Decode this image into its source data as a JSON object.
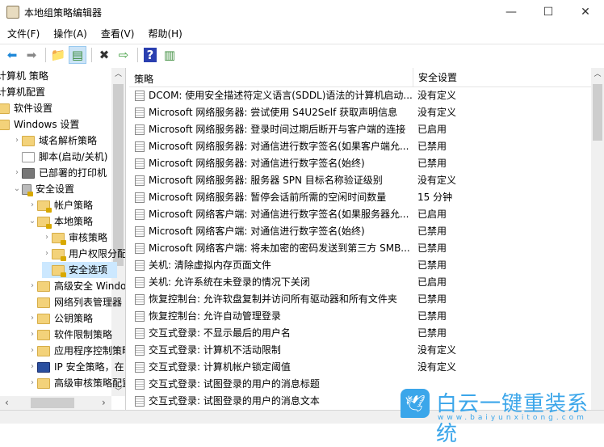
{
  "window": {
    "title": "本地组策略编辑器",
    "minimize": "—",
    "maximize": "☐",
    "close": "✕"
  },
  "menu": [
    "文件(F)",
    "操作(A)",
    "查看(V)",
    "帮助(H)"
  ],
  "toolbar": [
    {
      "icon": "back-arrow-icon",
      "glyph": "⬅",
      "color": "#1e88d8"
    },
    {
      "icon": "forward-arrow-icon",
      "glyph": "➡",
      "color": "#888888"
    },
    {
      "icon": "up-folder-icon",
      "glyph": "📁",
      "color": "#d6ad48"
    },
    {
      "icon": "show-hide-tree-icon",
      "glyph": "▤",
      "color": "#3c8c3c"
    },
    {
      "icon": "delete-icon",
      "glyph": "✖",
      "color": "#333333"
    },
    {
      "icon": "export-list-icon",
      "glyph": "⇨",
      "color": "#3c9c3c"
    },
    {
      "icon": "help-icon",
      "glyph": "?",
      "color": "#2a3fb0"
    },
    {
      "icon": "action-pane-icon",
      "glyph": "▥",
      "color": "#3c8c3c"
    }
  ],
  "tree": [
    {
      "label": "计算机 策略",
      "indent": 0,
      "chev": "",
      "icon": "none"
    },
    {
      "label": "计算机配置",
      "indent": 0,
      "chev": "",
      "icon": "none"
    },
    {
      "label": "软件设置",
      "indent": 0,
      "chev": "",
      "icon": "folder"
    },
    {
      "label": "Windows 设置",
      "indent": 0,
      "chev": "",
      "icon": "folder"
    },
    {
      "label": "域名解析策略",
      "indent": 1,
      "chev": "›",
      "icon": "folder"
    },
    {
      "label": "脚本(启动/关机)",
      "indent": 1,
      "chev": "",
      "icon": "script"
    },
    {
      "label": "已部署的打印机",
      "indent": 1,
      "chev": "›",
      "icon": "printer"
    },
    {
      "label": "安全设置",
      "indent": 1,
      "chev": "⌄",
      "icon": "security"
    },
    {
      "label": "帐户策略",
      "indent": 2,
      "chev": "›",
      "icon": "lockfolder"
    },
    {
      "label": "本地策略",
      "indent": 2,
      "chev": "⌄",
      "icon": "lockfolder"
    },
    {
      "label": "审核策略",
      "indent": 3,
      "chev": "›",
      "icon": "lockfolder"
    },
    {
      "label": "用户权限分配",
      "indent": 3,
      "chev": "›",
      "icon": "lockfolder"
    },
    {
      "label": "安全选项",
      "indent": 3,
      "chev": "",
      "icon": "lockfolder",
      "selected": true
    },
    {
      "label": "高级安全 Windows",
      "indent": 2,
      "chev": "›",
      "icon": "folder"
    },
    {
      "label": "网络列表管理器",
      "indent": 2,
      "chev": "",
      "icon": "folder"
    },
    {
      "label": "公钥策略",
      "indent": 2,
      "chev": "›",
      "icon": "folder"
    },
    {
      "label": "软件限制策略",
      "indent": 2,
      "chev": "›",
      "icon": "folder"
    },
    {
      "label": "应用程序控制策略",
      "indent": 2,
      "chev": "›",
      "icon": "folder"
    },
    {
      "label": "IP 安全策略，在",
      "indent": 2,
      "chev": "›",
      "icon": "ipsec"
    },
    {
      "label": "高级审核策略配置",
      "indent": 2,
      "chev": "›",
      "icon": "folder"
    }
  ],
  "list": {
    "columns": [
      "策略",
      "安全设置"
    ],
    "rows": [
      [
        "DCOM: 使用安全描述符定义语言(SDDL)语法的计算机启动...",
        "没有定义"
      ],
      [
        "Microsoft 网络服务器: 尝试使用 S4U2Self 获取声明信息",
        "没有定义"
      ],
      [
        "Microsoft 网络服务器: 登录时间过期后断开与客户端的连接",
        "已启用"
      ],
      [
        "Microsoft 网络服务器: 对通信进行数字签名(如果客户端允...",
        "已禁用"
      ],
      [
        "Microsoft 网络服务器: 对通信进行数字签名(始终)",
        "已禁用"
      ],
      [
        "Microsoft 网络服务器: 服务器 SPN 目标名称验证级别",
        "没有定义"
      ],
      [
        "Microsoft 网络服务器: 暂停会话前所需的空闲时间数量",
        "15 分钟"
      ],
      [
        "Microsoft 网络客户端: 对通信进行数字签名(如果服务器允...",
        "已启用"
      ],
      [
        "Microsoft 网络客户端: 对通信进行数字签名(始终)",
        "已禁用"
      ],
      [
        "Microsoft 网络客户端: 将未加密的密码发送到第三方 SMB...",
        "已禁用"
      ],
      [
        "关机: 清除虚拟内存页面文件",
        "已禁用"
      ],
      [
        "关机: 允许系统在未登录的情况下关闭",
        "已启用"
      ],
      [
        "恢复控制台: 允许软盘复制并访问所有驱动器和所有文件夹",
        "已禁用"
      ],
      [
        "恢复控制台: 允许自动管理登录",
        "已禁用"
      ],
      [
        "交互式登录: 不显示最后的用户名",
        "已禁用"
      ],
      [
        "交互式登录: 计算机不活动限制",
        "没有定义"
      ],
      [
        "交互式登录: 计算机帐户锁定阈值",
        "没有定义"
      ],
      [
        "交互式登录: 试图登录的用户的消息标题",
        ""
      ],
      [
        "交互式登录: 试图登录的用户的消息文本",
        ""
      ]
    ]
  },
  "watermark": {
    "brand": "白云一键重装系统",
    "url": "www.baiyunxitong.com"
  }
}
